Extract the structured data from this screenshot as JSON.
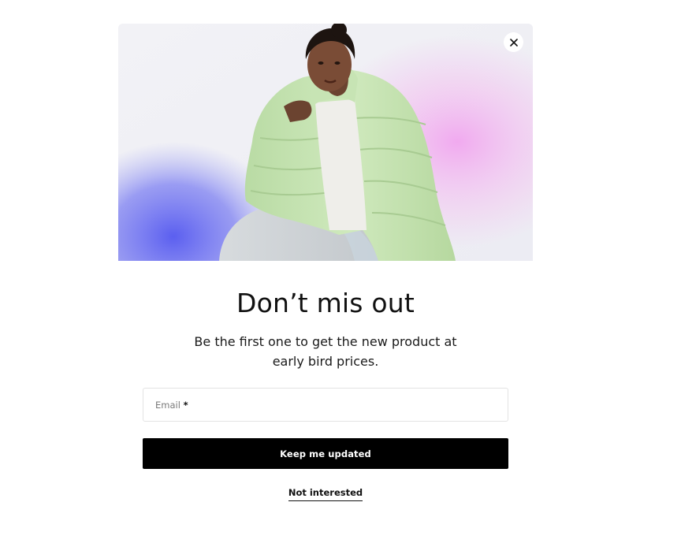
{
  "popup": {
    "title": "Don’t mis out",
    "subtitle": "Be the first one to get the new product at early bird prices.",
    "email_label": "Email",
    "email_required_marker": "*",
    "email_value": "",
    "submit_label": "Keep me updated",
    "dismiss_label": "Not interested",
    "close_icon": "close-icon",
    "hero_image": "woman-in-green-puffer-jacket"
  },
  "colors": {
    "button_bg": "#000000",
    "button_text": "#ffffff",
    "text": "#111111",
    "input_border": "#e3e3e3",
    "hero_blob_blue": "#6a6ff0",
    "hero_blob_pink": "#f3b7f0",
    "jacket_green": "#c4e3b0"
  }
}
